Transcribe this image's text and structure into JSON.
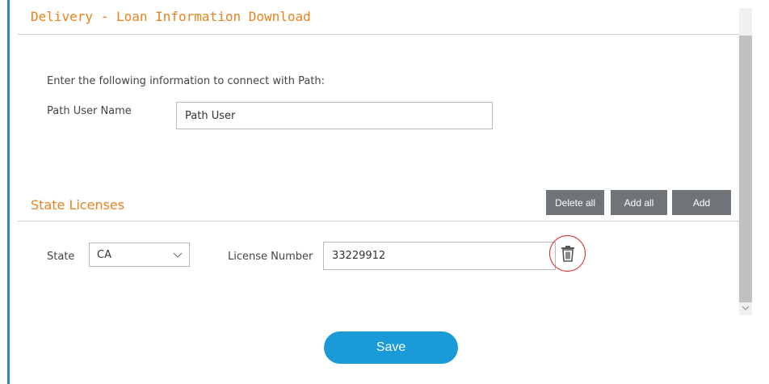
{
  "page": {
    "title": "Delivery - Loan Information Download"
  },
  "path_section": {
    "intro": "Enter the following information to connect with Path:",
    "user_label": "Path User Name",
    "user_value": "Path User"
  },
  "licenses": {
    "title": "State Licenses",
    "buttons": {
      "delete_all": "Delete all",
      "add_all": "Add all",
      "add": "Add"
    },
    "state_label": "State",
    "state_value": "CA",
    "license_label": "License Number",
    "license_value": "33229912"
  },
  "actions": {
    "save_label": "Save"
  },
  "colors": {
    "accent_orange": "#e8821e",
    "primary_blue": "#1a9ad6",
    "button_gray": "#6f7478",
    "highlight_red": "#d9252a"
  },
  "icons": {
    "delete": "trash-icon",
    "dropdown": "chevron-down-icon"
  }
}
